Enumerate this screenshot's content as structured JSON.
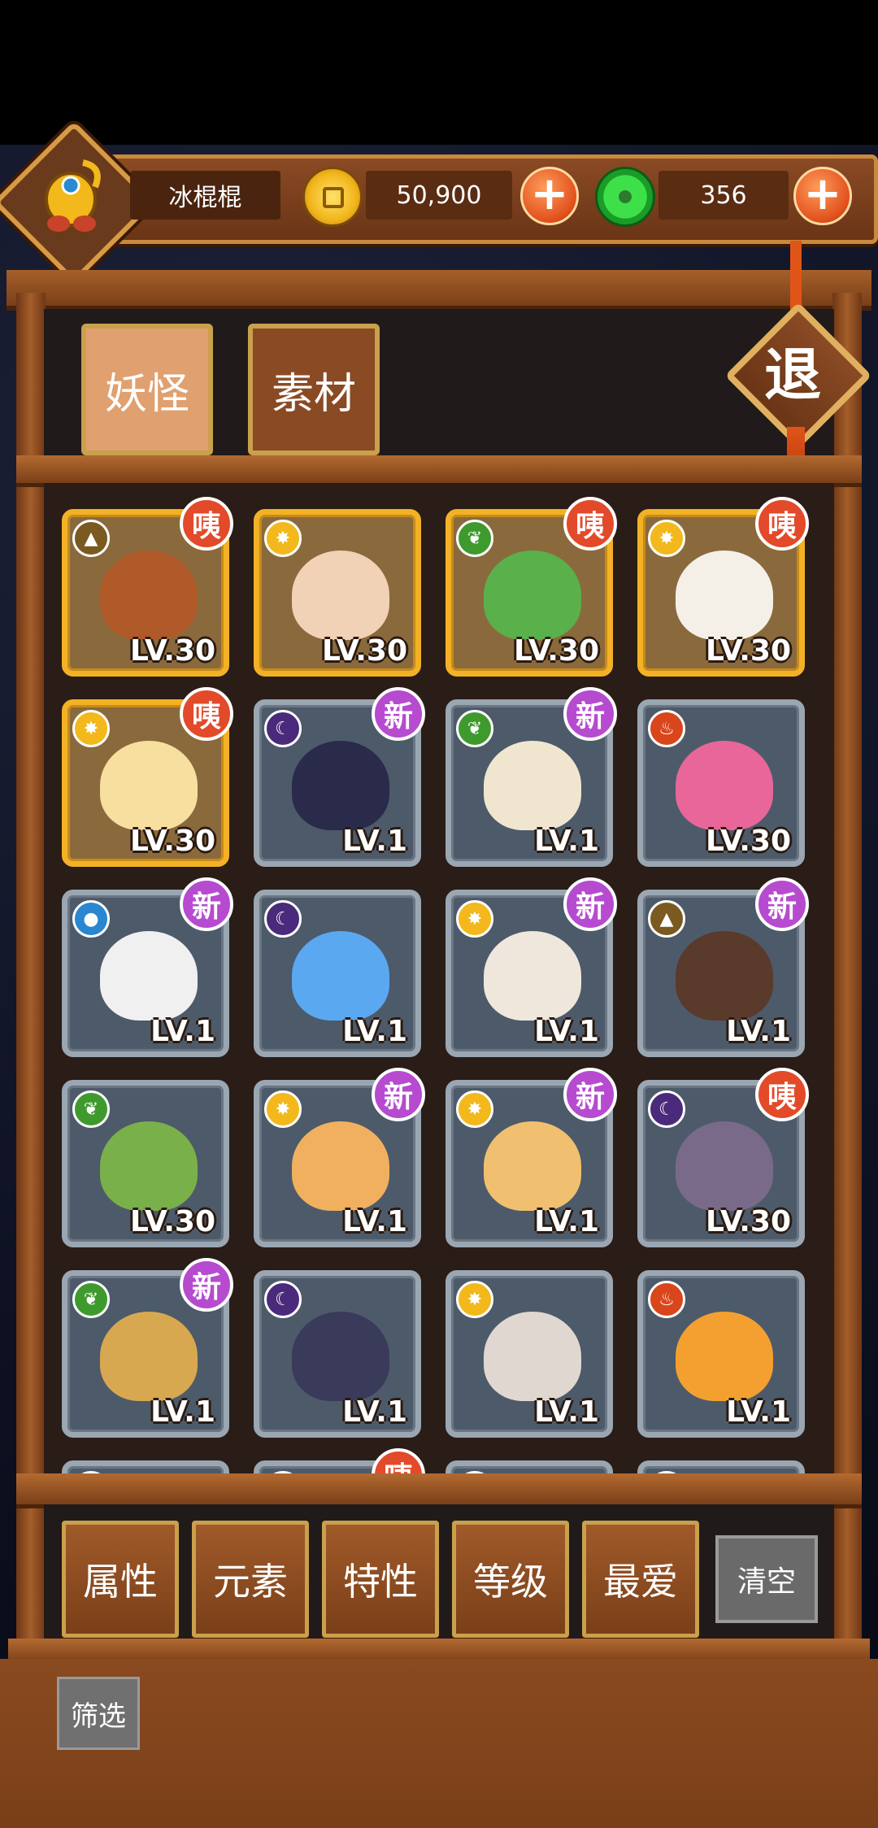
{
  "header": {
    "player_name": "冰棍棍",
    "coins": "50,900",
    "gems": "356",
    "plus": "+"
  },
  "tabs": [
    {
      "label": "妖怪"
    },
    {
      "label": "素材"
    }
  ],
  "exit_label": "退",
  "cards": [
    {
      "lv": "LV.30",
      "frame": "gold",
      "element": "earth",
      "tag": "咦",
      "tag_type": "red"
    },
    {
      "lv": "LV.30",
      "frame": "gold",
      "element": "light",
      "tag": "",
      "tag_type": ""
    },
    {
      "lv": "LV.30",
      "frame": "gold",
      "element": "wood",
      "tag": "咦",
      "tag_type": "red"
    },
    {
      "lv": "LV.30",
      "frame": "gold",
      "element": "light",
      "tag": "咦",
      "tag_type": "red"
    },
    {
      "lv": "LV.30",
      "frame": "gold",
      "element": "light",
      "tag": "咦",
      "tag_type": "red"
    },
    {
      "lv": "LV.1",
      "frame": "gray",
      "element": "dark",
      "tag": "新",
      "tag_type": "new"
    },
    {
      "lv": "LV.1",
      "frame": "gray",
      "element": "wood",
      "tag": "新",
      "tag_type": "new"
    },
    {
      "lv": "LV.30",
      "frame": "gray",
      "element": "fire",
      "tag": "",
      "tag_type": ""
    },
    {
      "lv": "LV.1",
      "frame": "gray",
      "element": "water",
      "tag": "新",
      "tag_type": "new"
    },
    {
      "lv": "LV.1",
      "frame": "gray",
      "element": "dark",
      "tag": "",
      "tag_type": ""
    },
    {
      "lv": "LV.1",
      "frame": "gray",
      "element": "light",
      "tag": "新",
      "tag_type": "new"
    },
    {
      "lv": "LV.1",
      "frame": "gray",
      "element": "earth",
      "tag": "新",
      "tag_type": "new"
    },
    {
      "lv": "LV.30",
      "frame": "gray",
      "element": "wood",
      "tag": "",
      "tag_type": ""
    },
    {
      "lv": "LV.1",
      "frame": "gray",
      "element": "light",
      "tag": "新",
      "tag_type": "new"
    },
    {
      "lv": "LV.1",
      "frame": "gray",
      "element": "light",
      "tag": "新",
      "tag_type": "new"
    },
    {
      "lv": "LV.30",
      "frame": "gray",
      "element": "dark",
      "tag": "咦",
      "tag_type": "red"
    },
    {
      "lv": "LV.1",
      "frame": "gray",
      "element": "wood",
      "tag": "新",
      "tag_type": "new"
    },
    {
      "lv": "LV.1",
      "frame": "gray",
      "element": "dark",
      "tag": "",
      "tag_type": ""
    },
    {
      "lv": "LV.1",
      "frame": "gray",
      "element": "light",
      "tag": "",
      "tag_type": ""
    },
    {
      "lv": "LV.1",
      "frame": "gray",
      "element": "fire",
      "tag": "",
      "tag_type": ""
    },
    {
      "lv": "",
      "frame": "gray",
      "element": "fire",
      "tag": "",
      "tag_type": ""
    },
    {
      "lv": "",
      "frame": "gray",
      "element": "wood",
      "tag": "咦",
      "tag_type": "red"
    },
    {
      "lv": "",
      "frame": "gray",
      "element": "dark",
      "tag": "",
      "tag_type": ""
    },
    {
      "lv": "",
      "frame": "gray",
      "element": "water",
      "tag": "",
      "tag_type": ""
    }
  ],
  "element_styles": {
    "earth": {
      "color": "#7a5a20",
      "icon": "mountain-icon"
    },
    "light": {
      "color": "#f2b81c",
      "icon": "sun-icon"
    },
    "wood": {
      "color": "#3f9a2e",
      "icon": "leaf-icon"
    },
    "dark": {
      "color": "#4a2a7a",
      "icon": "moon-icon"
    },
    "fire": {
      "color": "#d9461c",
      "icon": "flame-icon"
    },
    "water": {
      "color": "#2a86d0",
      "icon": "drop-icon"
    }
  },
  "sprite_colors": [
    "#b05a2a",
    "#f1d2b6",
    "#5ab04a",
    "#f4f0e8",
    "#f7dfa0",
    "#2a2a4a",
    "#f0e6d0",
    "#e8669a",
    "#f0f0f0",
    "#5aa8f0",
    "#efe6dc",
    "#5a3a2a",
    "#7ab04a",
    "#f0b060",
    "#f0c070",
    "#7a6a8a",
    "#d8a850",
    "#3a3a5a",
    "#e0d8d0",
    "#f4a030",
    "#6a6a6a",
    "#6a6a6a",
    "#6a6a6a",
    "#6a6a6a"
  ],
  "filters": [
    {
      "label": "属性"
    },
    {
      "label": "元素"
    },
    {
      "label": "特性"
    },
    {
      "label": "等级"
    },
    {
      "label": "最爱"
    }
  ],
  "clear_label": "清空",
  "screen_label": "筛选",
  "colors": {
    "gold_frame": "#f3b226",
    "gray_frame": "#9aa6b2",
    "new_tag": "#b64bd0",
    "red_tag": "#e24a2a",
    "tab_active": "#e0a070",
    "tab_inactive": "#8a4a24"
  }
}
